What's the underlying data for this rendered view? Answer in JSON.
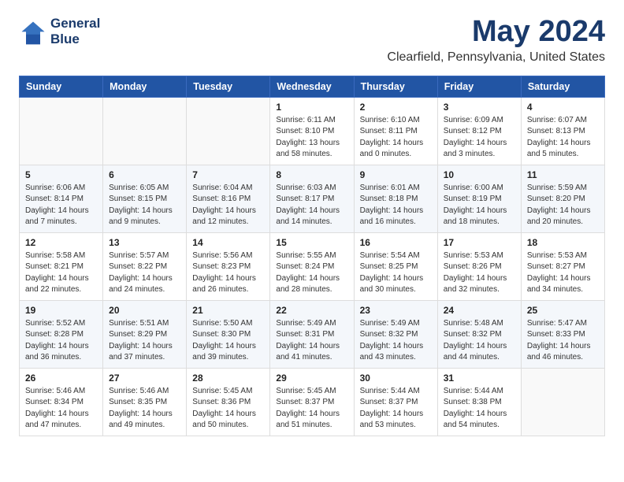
{
  "app": {
    "logo_line1": "General",
    "logo_line2": "Blue"
  },
  "header": {
    "title": "May 2024",
    "subtitle": "Clearfield, Pennsylvania, United States"
  },
  "calendar": {
    "weekdays": [
      "Sunday",
      "Monday",
      "Tuesday",
      "Wednesday",
      "Thursday",
      "Friday",
      "Saturday"
    ],
    "weeks": [
      [
        {
          "day": "",
          "info": ""
        },
        {
          "day": "",
          "info": ""
        },
        {
          "day": "",
          "info": ""
        },
        {
          "day": "1",
          "info": "Sunrise: 6:11 AM\nSunset: 8:10 PM\nDaylight: 13 hours\nand 58 minutes."
        },
        {
          "day": "2",
          "info": "Sunrise: 6:10 AM\nSunset: 8:11 PM\nDaylight: 14 hours\nand 0 minutes."
        },
        {
          "day": "3",
          "info": "Sunrise: 6:09 AM\nSunset: 8:12 PM\nDaylight: 14 hours\nand 3 minutes."
        },
        {
          "day": "4",
          "info": "Sunrise: 6:07 AM\nSunset: 8:13 PM\nDaylight: 14 hours\nand 5 minutes."
        }
      ],
      [
        {
          "day": "5",
          "info": "Sunrise: 6:06 AM\nSunset: 8:14 PM\nDaylight: 14 hours\nand 7 minutes."
        },
        {
          "day": "6",
          "info": "Sunrise: 6:05 AM\nSunset: 8:15 PM\nDaylight: 14 hours\nand 9 minutes."
        },
        {
          "day": "7",
          "info": "Sunrise: 6:04 AM\nSunset: 8:16 PM\nDaylight: 14 hours\nand 12 minutes."
        },
        {
          "day": "8",
          "info": "Sunrise: 6:03 AM\nSunset: 8:17 PM\nDaylight: 14 hours\nand 14 minutes."
        },
        {
          "day": "9",
          "info": "Sunrise: 6:01 AM\nSunset: 8:18 PM\nDaylight: 14 hours\nand 16 minutes."
        },
        {
          "day": "10",
          "info": "Sunrise: 6:00 AM\nSunset: 8:19 PM\nDaylight: 14 hours\nand 18 minutes."
        },
        {
          "day": "11",
          "info": "Sunrise: 5:59 AM\nSunset: 8:20 PM\nDaylight: 14 hours\nand 20 minutes."
        }
      ],
      [
        {
          "day": "12",
          "info": "Sunrise: 5:58 AM\nSunset: 8:21 PM\nDaylight: 14 hours\nand 22 minutes."
        },
        {
          "day": "13",
          "info": "Sunrise: 5:57 AM\nSunset: 8:22 PM\nDaylight: 14 hours\nand 24 minutes."
        },
        {
          "day": "14",
          "info": "Sunrise: 5:56 AM\nSunset: 8:23 PM\nDaylight: 14 hours\nand 26 minutes."
        },
        {
          "day": "15",
          "info": "Sunrise: 5:55 AM\nSunset: 8:24 PM\nDaylight: 14 hours\nand 28 minutes."
        },
        {
          "day": "16",
          "info": "Sunrise: 5:54 AM\nSunset: 8:25 PM\nDaylight: 14 hours\nand 30 minutes."
        },
        {
          "day": "17",
          "info": "Sunrise: 5:53 AM\nSunset: 8:26 PM\nDaylight: 14 hours\nand 32 minutes."
        },
        {
          "day": "18",
          "info": "Sunrise: 5:53 AM\nSunset: 8:27 PM\nDaylight: 14 hours\nand 34 minutes."
        }
      ],
      [
        {
          "day": "19",
          "info": "Sunrise: 5:52 AM\nSunset: 8:28 PM\nDaylight: 14 hours\nand 36 minutes."
        },
        {
          "day": "20",
          "info": "Sunrise: 5:51 AM\nSunset: 8:29 PM\nDaylight: 14 hours\nand 37 minutes."
        },
        {
          "day": "21",
          "info": "Sunrise: 5:50 AM\nSunset: 8:30 PM\nDaylight: 14 hours\nand 39 minutes."
        },
        {
          "day": "22",
          "info": "Sunrise: 5:49 AM\nSunset: 8:31 PM\nDaylight: 14 hours\nand 41 minutes."
        },
        {
          "day": "23",
          "info": "Sunrise: 5:49 AM\nSunset: 8:32 PM\nDaylight: 14 hours\nand 43 minutes."
        },
        {
          "day": "24",
          "info": "Sunrise: 5:48 AM\nSunset: 8:32 PM\nDaylight: 14 hours\nand 44 minutes."
        },
        {
          "day": "25",
          "info": "Sunrise: 5:47 AM\nSunset: 8:33 PM\nDaylight: 14 hours\nand 46 minutes."
        }
      ],
      [
        {
          "day": "26",
          "info": "Sunrise: 5:46 AM\nSunset: 8:34 PM\nDaylight: 14 hours\nand 47 minutes."
        },
        {
          "day": "27",
          "info": "Sunrise: 5:46 AM\nSunset: 8:35 PM\nDaylight: 14 hours\nand 49 minutes."
        },
        {
          "day": "28",
          "info": "Sunrise: 5:45 AM\nSunset: 8:36 PM\nDaylight: 14 hours\nand 50 minutes."
        },
        {
          "day": "29",
          "info": "Sunrise: 5:45 AM\nSunset: 8:37 PM\nDaylight: 14 hours\nand 51 minutes."
        },
        {
          "day": "30",
          "info": "Sunrise: 5:44 AM\nSunset: 8:37 PM\nDaylight: 14 hours\nand 53 minutes."
        },
        {
          "day": "31",
          "info": "Sunrise: 5:44 AM\nSunset: 8:38 PM\nDaylight: 14 hours\nand 54 minutes."
        },
        {
          "day": "",
          "info": ""
        }
      ]
    ]
  }
}
